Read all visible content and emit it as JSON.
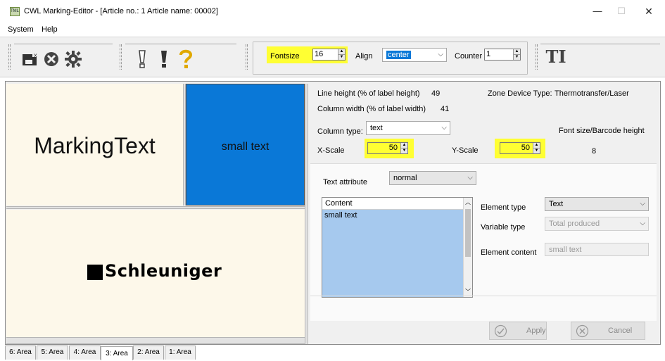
{
  "window": {
    "title": "CWL Marking-Editor - [Article no.: 1   Article name: 00002]",
    "app_icon_text": "TML",
    "min_glyph": "—",
    "max_glyph": "☐",
    "close_glyph": "✕"
  },
  "menu": [
    "System",
    "Help"
  ],
  "toolbar": {
    "fontsize_label": "Fontsize",
    "fontsize_value": "16",
    "align_label": "Align",
    "align_value": "center",
    "counter_label": "Counter",
    "counter_value": "1",
    "font_tool_glyph": "TI",
    "highlight_color": "#ffff33"
  },
  "areas": {
    "area1_text": "MarkingText",
    "area2_text": "small text",
    "area3_text": "Schleuniger",
    "area_bg": "#fdf8ea",
    "selected_bg": "#0a78d7"
  },
  "props": {
    "line_height_label": "Line height (% of label height)",
    "line_height_value": "49",
    "zone_label": "Zone Device Type:",
    "zone_value": "Thermotransfer/Laser",
    "column_width_label": "Column width (% of label width)",
    "column_width_value": "41",
    "column_type_label": "Column type:",
    "column_type_value": "text",
    "font_size_label": "Font size/Barcode height",
    "font_size_value": "8",
    "xscale_label": "X-Scale",
    "xscale_value": "50",
    "yscale_label": "Y-Scale",
    "yscale_value": "50"
  },
  "element": {
    "text_attribute_label": "Text attribute",
    "text_attribute_value": "normal",
    "content_header": "Content",
    "content_row": "small text",
    "element_type_label": "Element type",
    "element_type_value": "Text",
    "variable_type_label": "Variable type",
    "variable_type_value": "Total produced",
    "element_content_label": "Element content",
    "element_content_value": "small text"
  },
  "buttons": {
    "apply": "Apply",
    "cancel": "Cancel"
  },
  "tabs": [
    "6: Area",
    "5: Area",
    "4: Area",
    "3: Area",
    "2: Area",
    "1: Area"
  ]
}
